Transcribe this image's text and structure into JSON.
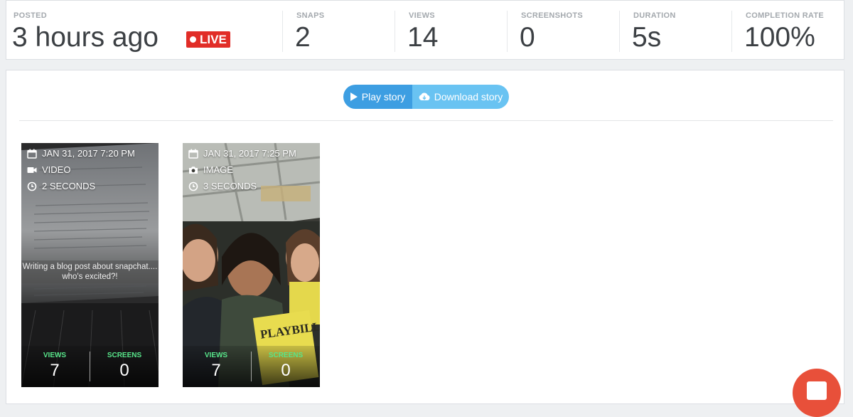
{
  "stats": {
    "posted": {
      "label": "POSTED",
      "value": "3 hours ago",
      "badge": "LIVE"
    },
    "snaps": {
      "label": "SNAPS",
      "value": "2"
    },
    "views": {
      "label": "VIEWS",
      "value": "14"
    },
    "screenshots": {
      "label": "SCREENSHOTS",
      "value": "0"
    },
    "duration": {
      "label": "DURATION",
      "value": "5s"
    },
    "completion": {
      "label": "COMPLETION RATE",
      "value": "100%"
    }
  },
  "actions": {
    "play_label": "Play story",
    "download_label": "Download story"
  },
  "snaps": [
    {
      "date": "JAN 31, 2017 7:20 PM",
      "type": "VIDEO",
      "type_icon": "video-camera-icon",
      "duration": "2 SECONDS",
      "caption": "Writing a blog post about snapchat.... who's excited?!",
      "views_label": "VIEWS",
      "views": "7",
      "screens_label": "SCREENS",
      "screens": "0"
    },
    {
      "date": "JAN 31, 2017 7:25 PM",
      "type": "IMAGE",
      "type_icon": "camera-icon",
      "duration": "3 SECONDS",
      "views_label": "VIEWS",
      "views": "7",
      "screens_label": "SCREENS",
      "screens": "0"
    }
  ],
  "colors": {
    "live": "#e12d27",
    "play_button": "#3d9ee2",
    "download_button": "#69c3f2",
    "stat_label_green": "#58e58a",
    "fab": "#e8503a"
  }
}
